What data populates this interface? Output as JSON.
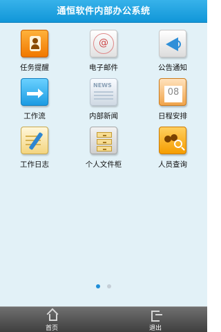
{
  "app": {
    "title": "通恒软件内部办公系统"
  },
  "menu": [
    {
      "label": "任务提醒",
      "icon": "task-reminder-icon"
    },
    {
      "label": "电子邮件",
      "icon": "email-icon"
    },
    {
      "label": "公告通知",
      "icon": "announcement-icon"
    },
    {
      "label": "工作流",
      "icon": "workflow-icon"
    },
    {
      "label": "内部新闻",
      "icon": "internal-news-icon"
    },
    {
      "label": "日程安排",
      "icon": "calendar-icon"
    },
    {
      "label": "工作日志",
      "icon": "work-log-icon"
    },
    {
      "label": "个人文件柜",
      "icon": "file-cabinet-icon"
    },
    {
      "label": "人员查询",
      "icon": "people-search-icon"
    }
  ],
  "icons_text": {
    "news_text": "NEWS",
    "calendar_day": "08"
  },
  "pager": {
    "current": 1,
    "total": 2
  },
  "bottom_nav": {
    "home_label": "首页",
    "exit_label": "退出"
  },
  "colors": {
    "title_bar": "#1ea6e6",
    "background": "#e2f1f7",
    "bottom_bar": "#4a4a4a",
    "active_dot": "#1f8ed8"
  }
}
